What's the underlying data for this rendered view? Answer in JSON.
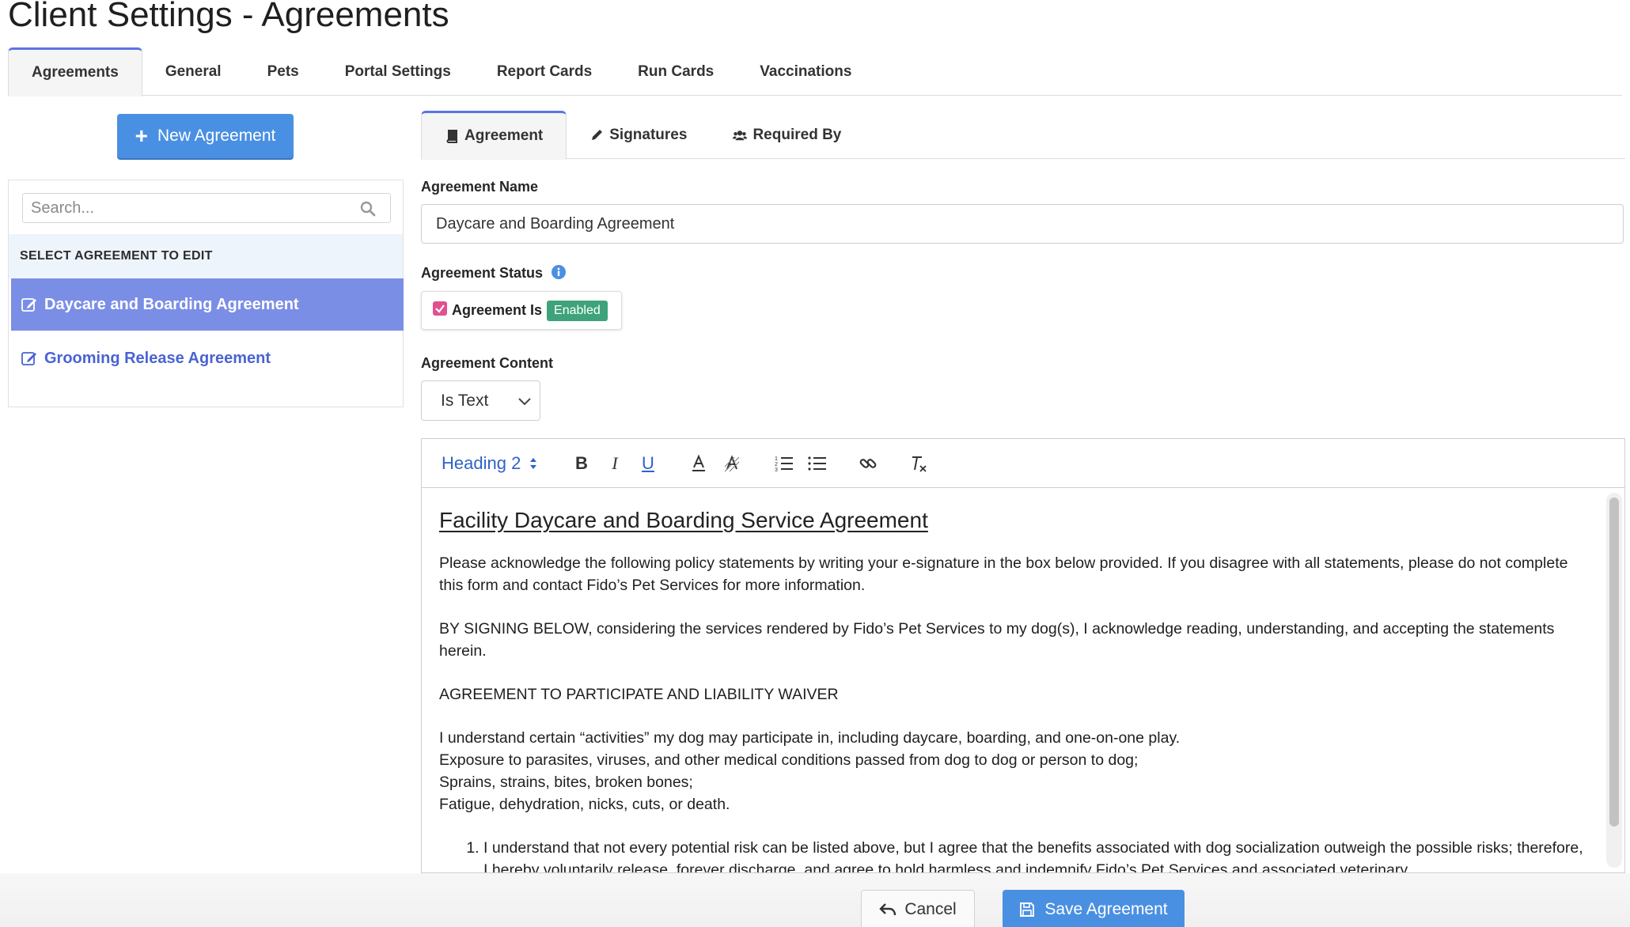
{
  "page_title": "Client Settings - Agreements",
  "top_tabs": [
    {
      "label": "Agreements",
      "active": true
    },
    {
      "label": "General",
      "active": false
    },
    {
      "label": "Pets",
      "active": false
    },
    {
      "label": "Portal Settings",
      "active": false
    },
    {
      "label": "Report Cards",
      "active": false
    },
    {
      "label": "Run Cards",
      "active": false
    },
    {
      "label": "Vaccinations",
      "active": false
    }
  ],
  "sidebar": {
    "new_button_label": "New Agreement",
    "search_placeholder": "Search...",
    "list_header": "SELECT AGREEMENT TO EDIT",
    "items": [
      {
        "label": "Daycare and Boarding Agreement",
        "selected": true
      },
      {
        "label": "Grooming Release Agreement",
        "selected": false
      }
    ]
  },
  "sub_tabs": [
    {
      "label": "Agreement",
      "icon": "book-icon",
      "active": true
    },
    {
      "label": "Signatures",
      "icon": "pencil-icon",
      "active": false
    },
    {
      "label": "Required By",
      "icon": "users-icon",
      "active": false
    }
  ],
  "form": {
    "name_label": "Agreement Name",
    "name_value": "Daycare and Boarding Agreement",
    "status_label": "Agreement Status",
    "status_checkbox_label": "Agreement Is",
    "status_badge": "Enabled",
    "status_checked": true,
    "content_label": "Agreement Content",
    "content_type": "Is Text"
  },
  "editor": {
    "heading_select": "Heading 2",
    "toolbar_buttons": [
      "bold",
      "italic",
      "underline",
      "text-color",
      "background-color",
      "ordered-list",
      "bullet-list",
      "link",
      "clear-format"
    ],
    "heading": "Facility Daycare and Boarding Service Agreement",
    "paragraph_1": "Please acknowledge the following policy statements by writing your e-signature in the box below provided. If you disagree with all statements, please do not complete this form and contact Fido’s Pet Services for more information.",
    "paragraph_2": "BY SIGNING BELOW, considering the services rendered by Fido’s Pet Services to my dog(s), I acknowledge reading, understanding, and accepting the statements herein.",
    "paragraph_3": "AGREEMENT TO PARTICIPATE AND LIABILITY WAIVER",
    "lines": [
      "I understand certain “activities” my dog may participate in, including daycare, boarding, and one-on-one play.",
      "Exposure to parasites, viruses, and other medical conditions passed from dog to dog or person to dog;",
      "Sprains, strains, bites, broken bones;",
      "Fatigue, dehydration, nicks, cuts, or death."
    ],
    "list_item_1": "I understand that not every potential risk can be listed above, but I agree that the benefits associated with dog socialization outweigh the possible risks; therefore, I hereby voluntarily release, forever discharge, and agree to hold harmless and indemnify Fido’s Pet Services and associated veterinary"
  },
  "actions": {
    "cancel_label": "Cancel",
    "save_label": "Save Agreement"
  },
  "colors": {
    "primary": "#4a90e2",
    "selected_item": "#7b8ee6",
    "badge": "#3ea37a",
    "checkbox": "#e0528f",
    "tab_accent": "#5b73e8"
  }
}
